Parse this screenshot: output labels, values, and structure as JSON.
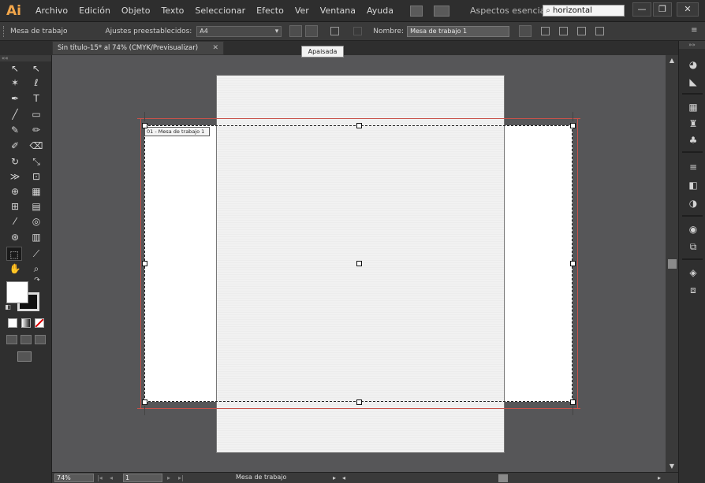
{
  "app": {
    "logo": "Ai"
  },
  "menu": [
    "Archivo",
    "Edición",
    "Objeto",
    "Texto",
    "Seleccionar",
    "Efecto",
    "Ver",
    "Ventana",
    "Ayuda"
  ],
  "workspace": {
    "label": "Aspectos esenciales",
    "arrow": "▾"
  },
  "search": {
    "value": "horizontal",
    "icon": "search-icon"
  },
  "window_controls": {
    "minimize": "—",
    "restore": "❐",
    "close": "✕"
  },
  "control_bar": {
    "tool_label": "Mesa de trabajo",
    "presets_label": "Ajustes preestablecidos:",
    "preset_value": "A4",
    "name_label": "Nombre:",
    "name_value": "Mesa de trabajo 1"
  },
  "tooltip": "Apaisada",
  "document_tab": {
    "title": "Sin título-15* al 74% (CMYK/Previsualizar)",
    "close": "✕"
  },
  "panel_collapse": {
    "left": "««",
    "right": "»»"
  },
  "artboard": {
    "label": "01 - Mesa de trabajo 1"
  },
  "status_bar": {
    "zoom": "74%",
    "page": "1",
    "mode_label": "Mesa de trabajo"
  }
}
